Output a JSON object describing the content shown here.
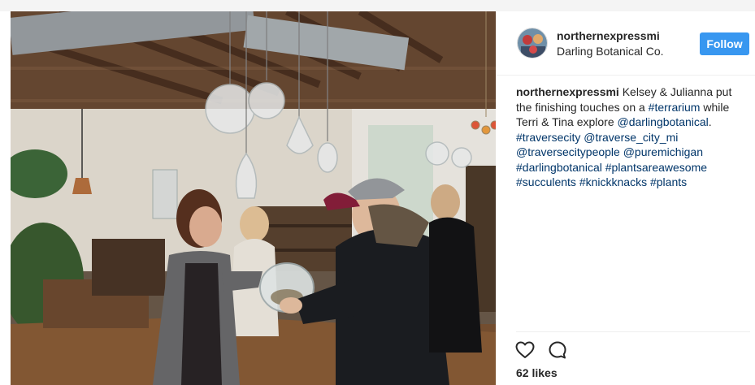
{
  "post": {
    "photo_alt": "",
    "username": "northernexpressmi",
    "location": "Darling Botanical Co.",
    "follow_label": "Follow",
    "caption": {
      "username": "northernexpressmi",
      "segments": [
        {
          "text": " Kelsey & Julianna put the finishing touches on a ",
          "type": "text"
        },
        {
          "text": "#terrarium",
          "type": "link"
        },
        {
          "text": " while Terri & Tina explore ",
          "type": "text"
        },
        {
          "text": "@darlingbotanical",
          "type": "link"
        },
        {
          "text": ". ",
          "type": "text"
        },
        {
          "text": "#traversecity",
          "type": "link"
        },
        {
          "text": " ",
          "type": "text"
        },
        {
          "text": "@traverse_city_mi",
          "type": "link"
        },
        {
          "text": " ",
          "type": "text"
        },
        {
          "text": "@traversecitypeople",
          "type": "link"
        },
        {
          "text": " ",
          "type": "text"
        },
        {
          "text": "@puremichigan",
          "type": "link"
        },
        {
          "text": " ",
          "type": "text"
        },
        {
          "text": "#darlingbotanical",
          "type": "link"
        },
        {
          "text": " ",
          "type": "text"
        },
        {
          "text": "#plantsareawesome",
          "type": "link"
        },
        {
          "text": " ",
          "type": "text"
        },
        {
          "text": "#succulents",
          "type": "link"
        },
        {
          "text": " ",
          "type": "text"
        },
        {
          "text": "#knickknacks",
          "type": "link"
        },
        {
          "text": " ",
          "type": "text"
        },
        {
          "text": "#plants",
          "type": "link"
        }
      ]
    },
    "likes_label": "62 likes",
    "icons": {
      "like": "heart-icon",
      "comment": "comment-icon"
    }
  },
  "colors": {
    "follow_button": "#3897f0",
    "link": "#003569",
    "text": "#262626",
    "divider": "#efefef"
  }
}
